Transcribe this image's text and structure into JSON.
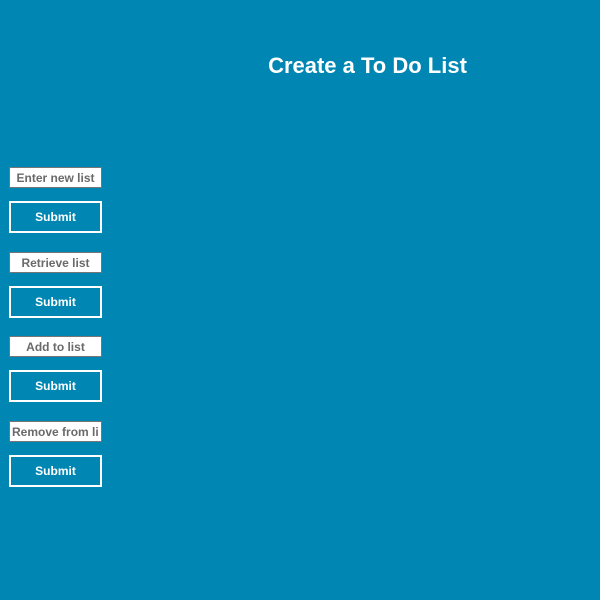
{
  "page": {
    "title": "Create a To Do List"
  },
  "forms": [
    {
      "placeholder": "Enter new list",
      "submit_label": "Submit"
    },
    {
      "placeholder": "Retrieve list",
      "submit_label": "Submit"
    },
    {
      "placeholder": "Add to list",
      "submit_label": "Submit"
    },
    {
      "placeholder": "Remove from list",
      "submit_label": "Submit"
    }
  ],
  "colors": {
    "background": "#0086b3",
    "text": "#ffffff"
  }
}
